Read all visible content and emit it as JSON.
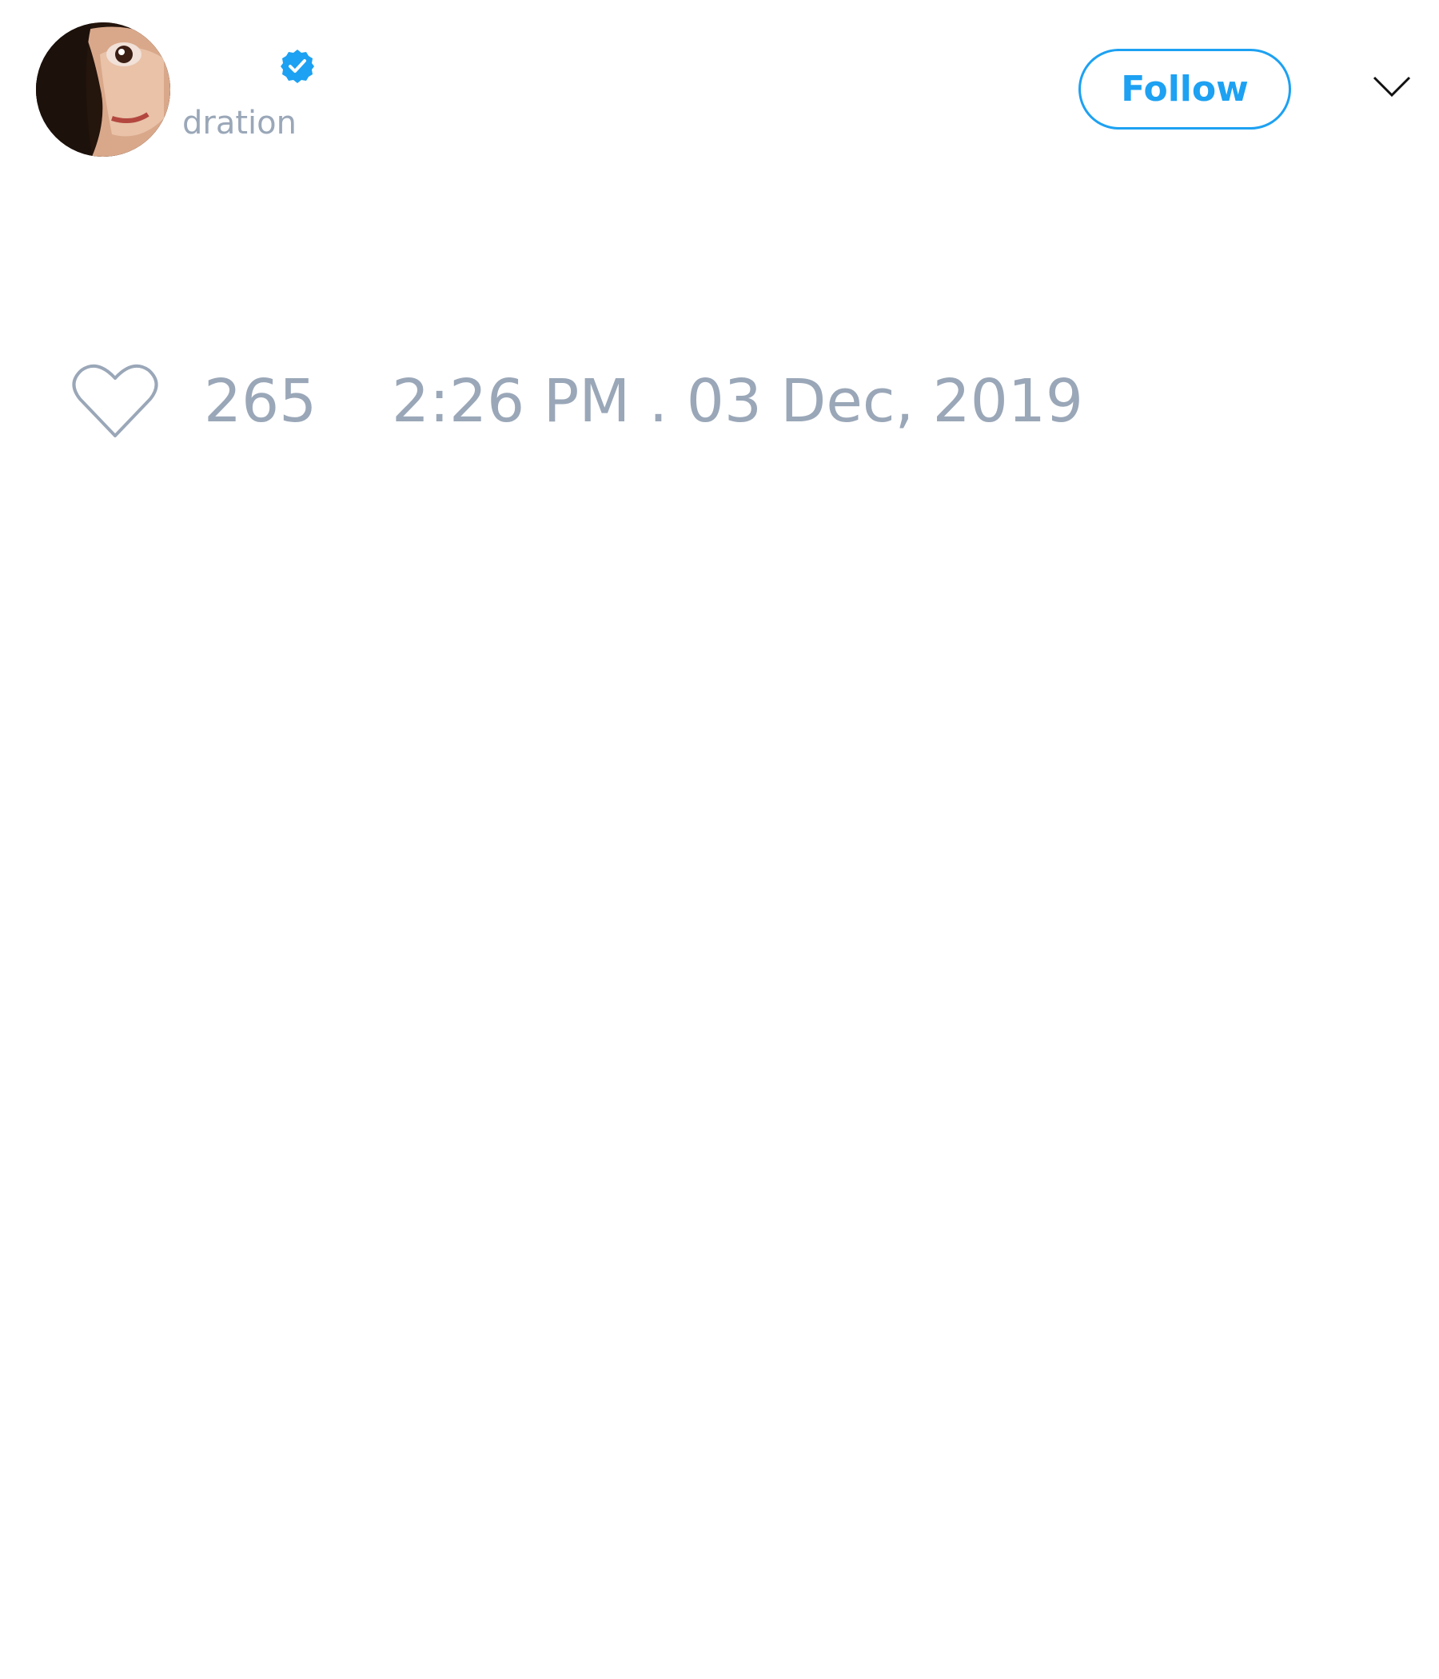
{
  "tweet": {
    "author": {
      "display_name": "",
      "username": "dration",
      "verified": true
    },
    "follow_label": "Follow",
    "like_count": "265",
    "timestamp": "2:26 PM . 03 Dec, 2019"
  },
  "colors": {
    "accent": "#1da1f2",
    "muted_text": "#9aa7b8",
    "background": "#ffffff"
  },
  "icons": {
    "verified": "verified-badge-icon",
    "menu": "chevron-down-icon",
    "like": "heart-icon"
  }
}
